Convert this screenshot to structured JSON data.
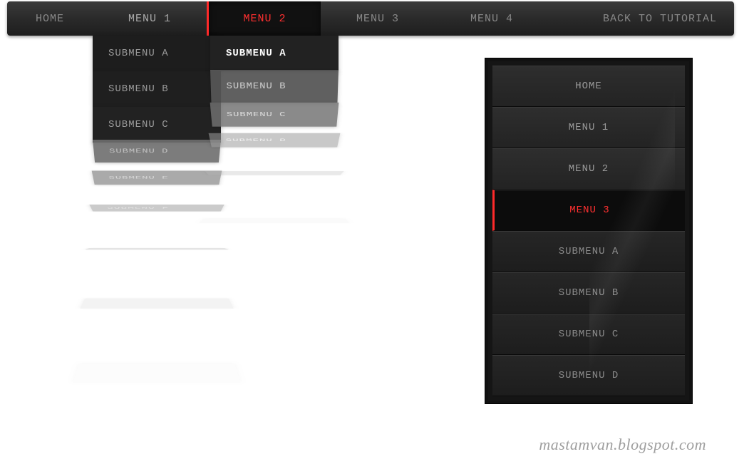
{
  "nav": {
    "home": "HOME",
    "menu1": "MENU 1",
    "menu2": "MENU 2",
    "menu3": "MENU 3",
    "menu4": "MENU 4",
    "back": "BACK TO TUTORIAL"
  },
  "dd1": {
    "a": "SUBMENU A",
    "b": "SUBMENU B",
    "c": "SUBMENU C",
    "d": "SUBMENU D",
    "e": "SUBMENU E",
    "f": "SUBMENU F"
  },
  "dd2": {
    "a": "SUBMENU A",
    "b": "SUBMENU B",
    "c": "SUBMENU C",
    "d": "SUBMENU D"
  },
  "mobile": {
    "home": "HOME",
    "m1": "MENU 1",
    "m2": "MENU 2",
    "m3": "MENU 3",
    "sa": "SUBMENU A",
    "sb": "SUBMENU B",
    "sc": "SUBMENU C",
    "sd": "SUBMENU D"
  },
  "credit": "mastamvan.blogspot.com",
  "colors": {
    "accent": "#ff3030",
    "bg_dark": "#1e1e1e"
  }
}
